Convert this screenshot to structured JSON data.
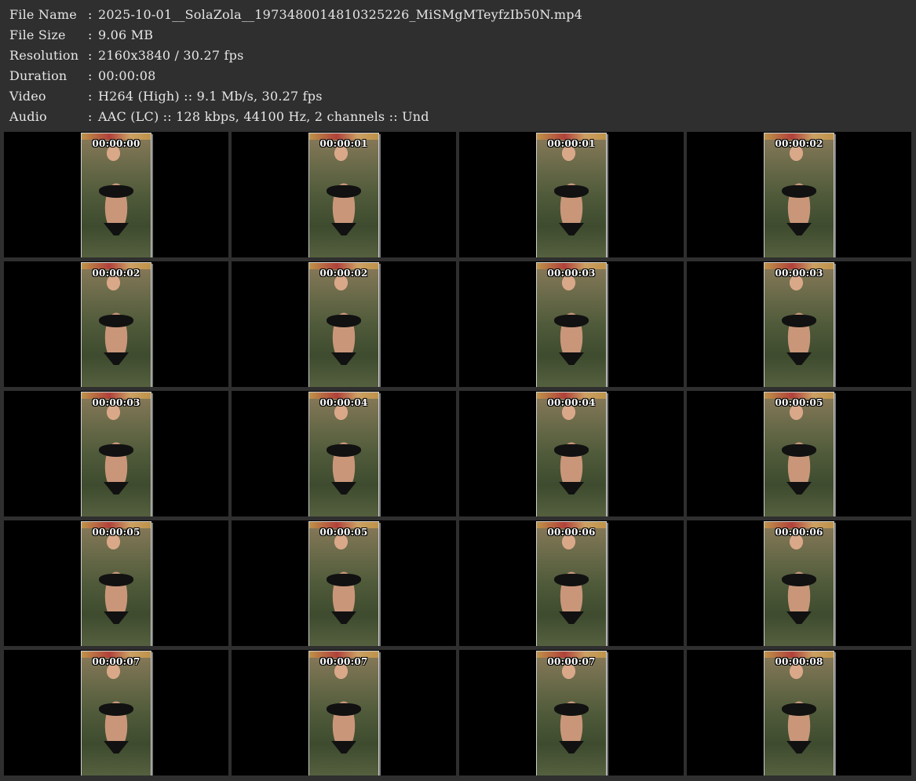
{
  "info": [
    {
      "label": "File Name",
      "sep": ":",
      "value": "2025-10-01__SolaZola__1973480014810325226_MiSMgMTeyfzIb50N.mp4"
    },
    {
      "label": "File Size",
      "sep": ":",
      "value": "9.06 MB"
    },
    {
      "label": "Resolution",
      "sep": ":",
      "value": "2160x3840 / 30.27 fps"
    },
    {
      "label": "Duration",
      "sep": ":",
      "value": "00:00:08"
    },
    {
      "label": "Video",
      "sep": ":",
      "value": "H264 (High) :: 9.1 Mb/s, 30.27 fps"
    },
    {
      "label": "Audio",
      "sep": ":",
      "value": "AAC (LC) :: 128 kbps, 44100 Hz, 2 channels :: Und"
    }
  ],
  "thumbnails": [
    {
      "timecode": "00:00:00"
    },
    {
      "timecode": "00:00:01"
    },
    {
      "timecode": "00:00:01"
    },
    {
      "timecode": "00:00:02"
    },
    {
      "timecode": "00:00:02"
    },
    {
      "timecode": "00:00:02"
    },
    {
      "timecode": "00:00:03"
    },
    {
      "timecode": "00:00:03"
    },
    {
      "timecode": "00:00:03"
    },
    {
      "timecode": "00:00:04"
    },
    {
      "timecode": "00:00:04"
    },
    {
      "timecode": "00:00:05"
    },
    {
      "timecode": "00:00:05"
    },
    {
      "timecode": "00:00:05"
    },
    {
      "timecode": "00:00:06"
    },
    {
      "timecode": "00:00:06"
    },
    {
      "timecode": "00:00:07"
    },
    {
      "timecode": "00:00:07"
    },
    {
      "timecode": "00:00:07"
    },
    {
      "timecode": "00:00:08"
    }
  ]
}
